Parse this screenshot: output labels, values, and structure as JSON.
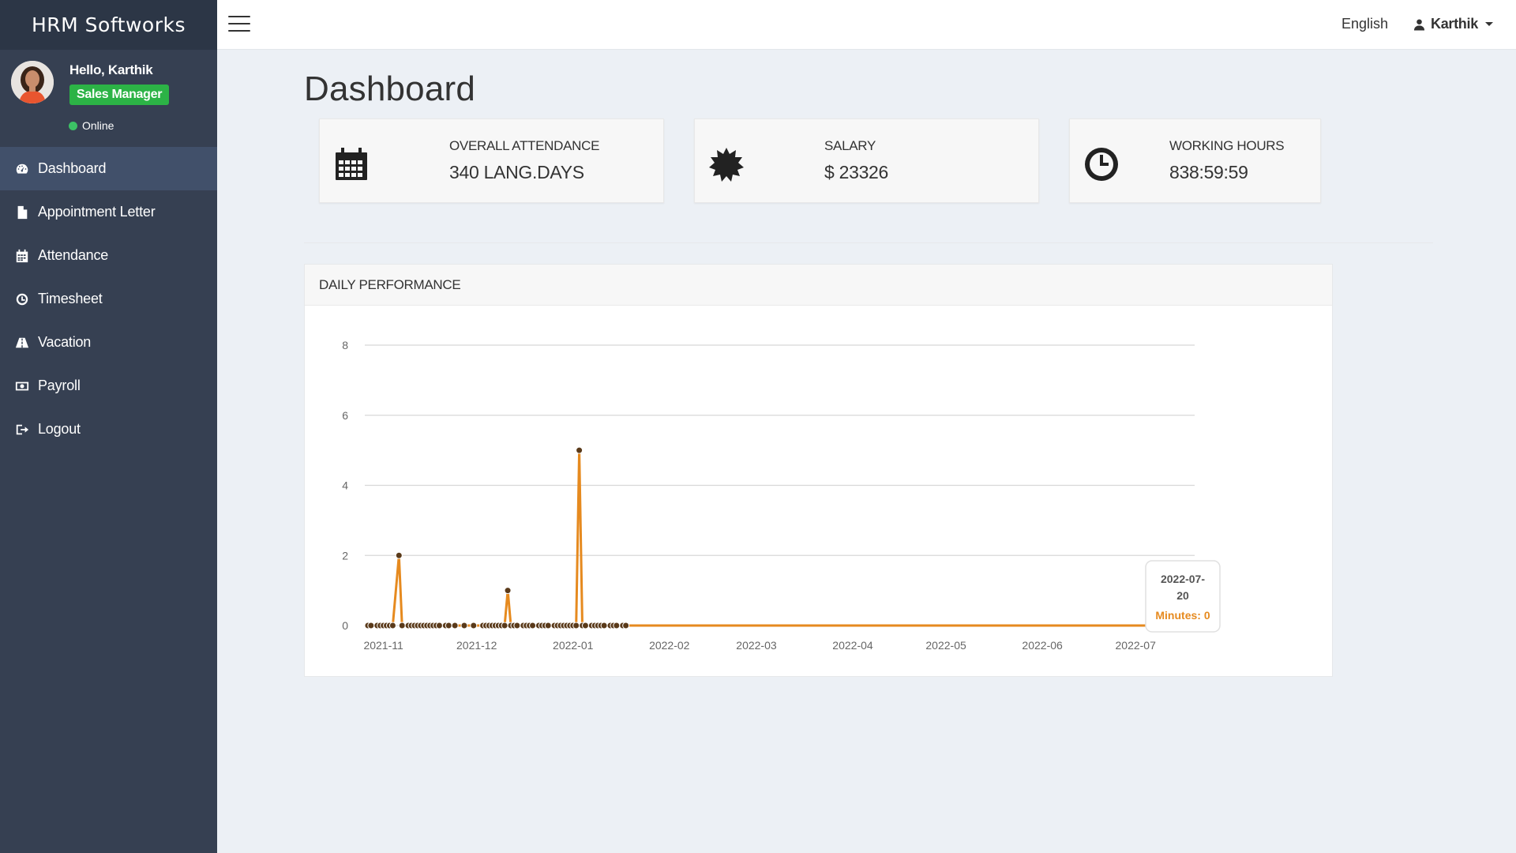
{
  "app": {
    "brand": "HRM Softworks"
  },
  "user": {
    "greeting": "Hello, Karthik",
    "role": "Sales Manager",
    "status": "Online",
    "name": "Karthik"
  },
  "topbar": {
    "language": "English"
  },
  "sidebar": {
    "items": [
      {
        "label": "Dashboard",
        "icon": "dashboard-icon",
        "active": true
      },
      {
        "label": "Appointment Letter",
        "icon": "file-icon",
        "active": false
      },
      {
        "label": "Attendance",
        "icon": "calendar-icon",
        "active": false
      },
      {
        "label": "Timesheet",
        "icon": "clock-icon",
        "active": false
      },
      {
        "label": "Vacation",
        "icon": "road-icon",
        "active": false
      },
      {
        "label": "Payroll",
        "icon": "money-icon",
        "active": false
      },
      {
        "label": "Logout",
        "icon": "sign-out-icon",
        "active": false
      }
    ]
  },
  "page": {
    "title": "Dashboard"
  },
  "stats": [
    {
      "label": "OVERALL ATTENDANCE",
      "value": "340 LANG.DAYS",
      "icon": "calendar-icon"
    },
    {
      "label": "SALARY",
      "value": "$ 23326",
      "icon": "certificate-icon"
    },
    {
      "label": "WORKING HOURS",
      "value": "838:59:59",
      "icon": "clock-icon"
    }
  ],
  "panel": {
    "title": "DAILY PERFORMANCE"
  },
  "colors": {
    "sidebar": "#364052",
    "brand_bg": "#2c3646",
    "active_item": "#41506a",
    "badge": "#2cb346",
    "line": "#e68a1f",
    "marker": "#5a3a1a"
  },
  "chart_data": {
    "type": "line",
    "ylim": [
      0,
      8
    ],
    "yticks": [
      0,
      2,
      4,
      6,
      8
    ],
    "xticks": [
      "2021-11",
      "2021-12",
      "2022-01",
      "2022-02",
      "2022-03",
      "2022-04",
      "2022-05",
      "2022-06",
      "2022-07"
    ],
    "x_range": [
      "2021-10-26",
      "2022-07-20"
    ],
    "series_name": "Minutes",
    "points": [
      {
        "x": "2021-10-27",
        "y": 0
      },
      {
        "x": "2021-10-28",
        "y": 0
      },
      {
        "x": "2021-10-30",
        "y": 0
      },
      {
        "x": "2021-10-31",
        "y": 0
      },
      {
        "x": "2021-11-01",
        "y": 0
      },
      {
        "x": "2021-11-02",
        "y": 0
      },
      {
        "x": "2021-11-03",
        "y": 0
      },
      {
        "x": "2021-11-04",
        "y": 0
      },
      {
        "x": "2021-11-06",
        "y": 2
      },
      {
        "x": "2021-11-07",
        "y": 0
      },
      {
        "x": "2021-11-09",
        "y": 0
      },
      {
        "x": "2021-11-10",
        "y": 0
      },
      {
        "x": "2021-11-11",
        "y": 0
      },
      {
        "x": "2021-11-12",
        "y": 0
      },
      {
        "x": "2021-11-13",
        "y": 0
      },
      {
        "x": "2021-11-14",
        "y": 0
      },
      {
        "x": "2021-11-15",
        "y": 0
      },
      {
        "x": "2021-11-16",
        "y": 0
      },
      {
        "x": "2021-11-17",
        "y": 0
      },
      {
        "x": "2021-11-18",
        "y": 0
      },
      {
        "x": "2021-11-19",
        "y": 0
      },
      {
        "x": "2021-11-21",
        "y": 0
      },
      {
        "x": "2021-11-22",
        "y": 0
      },
      {
        "x": "2021-11-24",
        "y": 0
      },
      {
        "x": "2021-11-27",
        "y": 0
      },
      {
        "x": "2021-11-30",
        "y": 0
      },
      {
        "x": "2021-12-03",
        "y": 0
      },
      {
        "x": "2021-12-04",
        "y": 0
      },
      {
        "x": "2021-12-05",
        "y": 0
      },
      {
        "x": "2021-12-06",
        "y": 0
      },
      {
        "x": "2021-12-07",
        "y": 0
      },
      {
        "x": "2021-12-08",
        "y": 0
      },
      {
        "x": "2021-12-09",
        "y": 0
      },
      {
        "x": "2021-12-10",
        "y": 0
      },
      {
        "x": "2021-12-11",
        "y": 1
      },
      {
        "x": "2021-12-12",
        "y": 0
      },
      {
        "x": "2021-12-13",
        "y": 0
      },
      {
        "x": "2021-12-14",
        "y": 0
      },
      {
        "x": "2021-12-16",
        "y": 0
      },
      {
        "x": "2021-12-17",
        "y": 0
      },
      {
        "x": "2021-12-18",
        "y": 0
      },
      {
        "x": "2021-12-19",
        "y": 0
      },
      {
        "x": "2021-12-21",
        "y": 0
      },
      {
        "x": "2021-12-22",
        "y": 0
      },
      {
        "x": "2021-12-23",
        "y": 0
      },
      {
        "x": "2021-12-24",
        "y": 0
      },
      {
        "x": "2021-12-26",
        "y": 0
      },
      {
        "x": "2021-12-27",
        "y": 0
      },
      {
        "x": "2021-12-28",
        "y": 0
      },
      {
        "x": "2021-12-29",
        "y": 0
      },
      {
        "x": "2021-12-30",
        "y": 0
      },
      {
        "x": "2021-12-31",
        "y": 0
      },
      {
        "x": "2022-01-01",
        "y": 0
      },
      {
        "x": "2022-01-02",
        "y": 0
      },
      {
        "x": "2022-01-03",
        "y": 5
      },
      {
        "x": "2022-01-04",
        "y": 0
      },
      {
        "x": "2022-01-05",
        "y": 0
      },
      {
        "x": "2022-01-07",
        "y": 0
      },
      {
        "x": "2022-01-08",
        "y": 0
      },
      {
        "x": "2022-01-09",
        "y": 0
      },
      {
        "x": "2022-01-10",
        "y": 0
      },
      {
        "x": "2022-01-11",
        "y": 0
      },
      {
        "x": "2022-01-13",
        "y": 0
      },
      {
        "x": "2022-01-14",
        "y": 0
      },
      {
        "x": "2022-01-15",
        "y": 0
      },
      {
        "x": "2022-01-17",
        "y": 0
      },
      {
        "x": "2022-01-18",
        "y": 0
      },
      {
        "x": "2022-07-20",
        "y": 0
      }
    ],
    "tooltip": {
      "date": "2022-07-20",
      "label": "Minutes: 0"
    }
  }
}
